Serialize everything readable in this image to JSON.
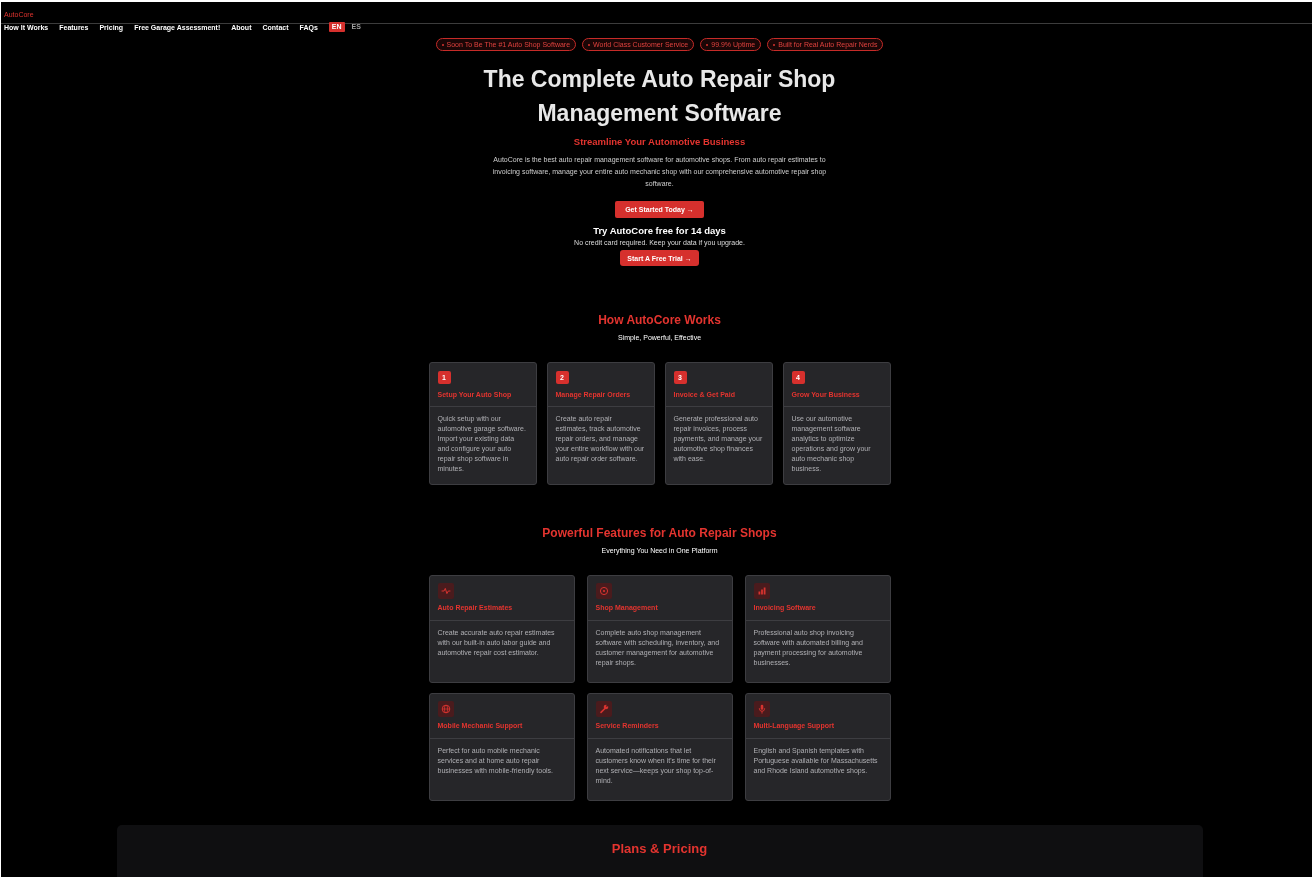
{
  "nav": {
    "brand": "AutoCore",
    "links": [
      {
        "label": "How It Works"
      },
      {
        "label": "Features"
      },
      {
        "label": "Pricing"
      },
      {
        "label": "Free Garage Assessment!"
      },
      {
        "label": "About"
      },
      {
        "label": "Contact"
      },
      {
        "label": "FAQs"
      }
    ],
    "languages": [
      {
        "label": "EN",
        "selected": true
      },
      {
        "label": "ES",
        "selected": false
      }
    ]
  },
  "hero": {
    "badges": [
      "Soon To Be The #1 Auto Shop Software",
      "World Class Customer Service",
      "99.9% Uptime",
      "Built for Real Auto Repair Nerds"
    ],
    "title": "The Complete Auto Repair Shop Management Software",
    "subtitle": "Streamline Your Automotive Business",
    "description": "AutoCore is the best auto repair management software for automotive shops. From auto repair estimates to invoicing software, manage your entire auto mechanic shop with our comprehensive automotive repair shop software.",
    "cta": "Get Started Today →",
    "trial": {
      "title": "Try AutoCore free for 14 days",
      "note": "No credit card required. Keep your data if you upgrade.",
      "button": "Start A Free Trial →"
    }
  },
  "how_it_works": {
    "title": "How AutoCore Works",
    "subtitle": "Simple, Powerful, Effective",
    "steps": [
      {
        "number": "1",
        "title": "Setup Your Auto Shop",
        "text": "Quick setup with our automotive garage software. Import your existing data and configure your auto repair shop software in minutes."
      },
      {
        "number": "2",
        "title": "Manage Repair Orders",
        "text": "Create auto repair estimates, track automotive repair orders, and manage your entire workflow with our auto repair order software."
      },
      {
        "number": "3",
        "title": "Invoice & Get Paid",
        "text": "Generate professional auto repair invoices, process payments, and manage your automotive shop finances with ease."
      },
      {
        "number": "4",
        "title": "Grow Your Business",
        "text": "Use our automotive management software analytics to optimize operations and grow your auto mechanic shop business."
      }
    ]
  },
  "features": {
    "title": "Powerful Features for Auto Repair Shops",
    "subtitle": "Everything You Need in One Platform",
    "items": [
      {
        "title": "Auto Repair Estimates",
        "text": "Create accurate auto repair estimates with our built-in auto labor guide and automotive repair cost estimator."
      },
      {
        "title": "Shop Management",
        "text": "Complete auto shop management software with scheduling, inventory, and customer management for automotive repair shops."
      },
      {
        "title": "Invoicing Software",
        "text": "Professional auto shop invoicing software with automated billing and payment processing for automotive businesses."
      },
      {
        "title": "Mobile Mechanic Support",
        "text": "Perfect for auto mobile mechanic services and at home auto repair businesses with mobile-friendly tools."
      },
      {
        "title": "Service Reminders",
        "text": "Automated notifications that let customers know when it's time for their next service—keeps your shop top-of-mind."
      },
      {
        "title": "Multi-Language Support",
        "text": "English and Spanish templates with Portuguese available for Massachusetts and Rhode Island automotive shops."
      }
    ]
  },
  "pricing": {
    "title": "Plans & Pricing"
  }
}
